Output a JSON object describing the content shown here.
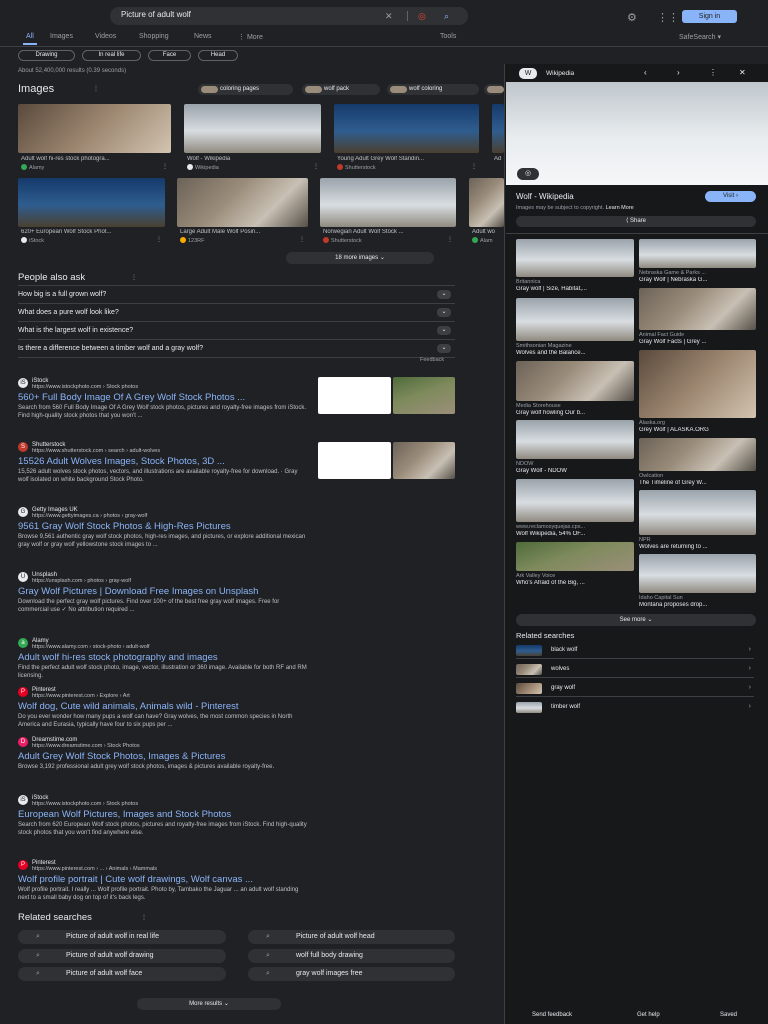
{
  "search": {
    "query": "Picture of adult wolf"
  },
  "header": {
    "signin": "Sign in"
  },
  "tabs": [
    "All",
    "Images",
    "Videos",
    "Shopping",
    "News",
    "⋮ More",
    "Tools",
    "SafeSearch ▾"
  ],
  "chips": [
    "Drawing",
    "In real life",
    "Face",
    "Head"
  ],
  "stats": "About 52,400,000 results (0.39 seconds)",
  "images": {
    "title": "Images",
    "suggestions": [
      "coloring pages",
      "wolf pack",
      "wolf coloring"
    ],
    "row1": [
      {
        "caption": "Adult wolf hi-res stock photogra...",
        "source": "Alamy"
      },
      {
        "caption": "Wolf - Wikipedia",
        "source": "Wikipedia"
      },
      {
        "caption": "Young Adult Grey Wolf Standin...",
        "source": "Shutterstock"
      },
      {
        "caption": "Ad",
        "source": ""
      }
    ],
    "row2": [
      {
        "caption": "620+ European Wolf Stock Phot...",
        "source": "iStock"
      },
      {
        "caption": "Large Adult Male Wolf Posin...",
        "source": "123RF"
      },
      {
        "caption": "Norwegian Adult Wolf Stock ...",
        "source": "Shutterstock"
      },
      {
        "caption": "Adult wo",
        "source": "Alam"
      }
    ],
    "more": "18 more images"
  },
  "paa": {
    "title": "People also ask",
    "questions": [
      "How big is a full grown wolf?",
      "What does a pure wolf look like?",
      "What is the largest wolf in existence?",
      "Is there a difference between a timber wolf and a gray wolf?"
    ],
    "feedback": "Feedback"
  },
  "results": [
    {
      "site": "iStock",
      "url": "https://www.istockphoto.com › Stock photos",
      "title": "560+ Full Body Image Of A Grey Wolf Stock Photos ...",
      "snippet": "Search from 560 Full Body Image Of A Grey Wolf stock photos, pictures and royalty-free images from iStock. Find high-quality stock photos that you won't ..."
    },
    {
      "site": "Shutterstock",
      "url": "https://www.shutterstock.com › search › adult-wolves",
      "title": "15526 Adult Wolves Images, Stock Photos, 3D ...",
      "snippet": "15,526 adult wolves stock photos, vectors, and illustrations are available royalty-free for download. · Gray wolf isolated on white background Stock Photo."
    },
    {
      "site": "Getty Images UK",
      "url": "https://www.gettyimages.ca › photos › gray-wolf",
      "title": "9561 Gray Wolf Stock Photos & High-Res Pictures",
      "snippet": "Browse 9,561 authentic gray wolf stock photos, high-res images, and pictures, or explore additional mexican gray wolf or gray wolf yellowstone stock images to ..."
    },
    {
      "site": "Unsplash",
      "url": "https://unsplash.com › photos › gray-wolf",
      "title": "Gray Wolf Pictures | Download Free Images on Unsplash",
      "snippet": "Download the perfect gray wolf pictures. Find over 100+ of the best free gray wolf images. Free for commercial use ✓ No attribution required ..."
    },
    {
      "site": "Alamy",
      "url": "https://www.alamy.com › stock-photo › adult-wolf",
      "title": "Adult wolf hi-res stock photography and images",
      "snippet": "Find the perfect adult wolf stock photo, image, vector, illustration or 360 image. Available for both RF and RM licensing."
    },
    {
      "site": "Pinterest",
      "url": "https://www.pinterest.com › Explore › Art",
      "title": "Wolf dog, Cute wild animals, Animals wild - Pinterest",
      "snippet": "Do you ever wonder how many pups a wolf can have? Gray wolves, the most common species in North America and Eurasia, typically have four to six pups per ..."
    },
    {
      "site": "Dreamstime.com",
      "url": "https://www.dreamstime.com › Stock Photos",
      "title": "Adult Grey Wolf Stock Photos, Images & Pictures",
      "snippet": "Browse 3,192 professional adult grey wolf stock photos, images & pictures available royalty-free."
    },
    {
      "site": "iStock",
      "url": "https://www.istockphoto.com › Stock photos",
      "title": "European Wolf Pictures, Images and Stock Photos",
      "snippet": "Search from 620 European Wolf stock photos, pictures and royalty-free images from iStock. Find high-quality stock photos that you won't find anywhere else."
    },
    {
      "site": "Pinterest",
      "url": "https://www.pinterest.com › ... › Animals › Mammals",
      "title": "Wolf profile portrait | Cute wolf drawings, Wolf canvas ...",
      "snippet": "Wolf profile portrait. I really ... Wolf profile portrait. Photo by, Tambako the Jaguar ... an adult wolf standing next to a small baby dog on top of it's back legs."
    }
  ],
  "related": {
    "title": "Related searches",
    "items": [
      "Picture of adult wolf in real life",
      "Picture of adult wolf head",
      "Picture of adult wolf drawing",
      "wolf full body drawing",
      "Picture of adult wolf face",
      "gray wolf images free"
    ]
  },
  "more_results": "More results",
  "panel": {
    "site": "Wikipedia",
    "title": "Wolf - Wikipedia",
    "visit": "Visit",
    "copyright": "Images may be subject to copyright.",
    "learn_more": "Learn More",
    "share": "Share",
    "tiles": [
      {
        "source": "Britannica",
        "caption": "Gray wolf | Size, Habitat,..."
      },
      {
        "source": "Nebraska Game & Parks ...",
        "caption": "Gray Wolf | Nebraska G..."
      },
      {
        "source": "Smithsonian Magazine",
        "caption": "Wolves and the Balance..."
      },
      {
        "source": "Animal Fact Guide",
        "caption": "Gray Wolf Facts | Grey ..."
      },
      {
        "source": "Media Storehouse",
        "caption": "Gray wolf howling Our b..."
      },
      {
        "source": "Alaska.org",
        "caption": "Grey Wolf | ALASKA.ORG"
      },
      {
        "source": "NDOW",
        "caption": "Gray Wolf - NDOW"
      },
      {
        "source": "Owlcation",
        "caption": "The Timeline of Grey W..."
      },
      {
        "source": "www.reclamosyquejas.cps...",
        "caption": "Wolf Wikipedia, 54% OF..."
      },
      {
        "source": "NPR",
        "caption": "Wolves are returning to ..."
      },
      {
        "source": "Ark Valley Voice",
        "caption": "Who's Afraid of the Big, ..."
      },
      {
        "source": "Idaho Capital Sun",
        "caption": "Montana proposes drop..."
      }
    ],
    "see_more": "See more",
    "related_title": "Related searches",
    "related": [
      "black wolf",
      "wolves",
      "gray wolf",
      "timber wolf"
    ]
  },
  "footer": [
    "Send feedback",
    "Get help",
    "Saved"
  ]
}
